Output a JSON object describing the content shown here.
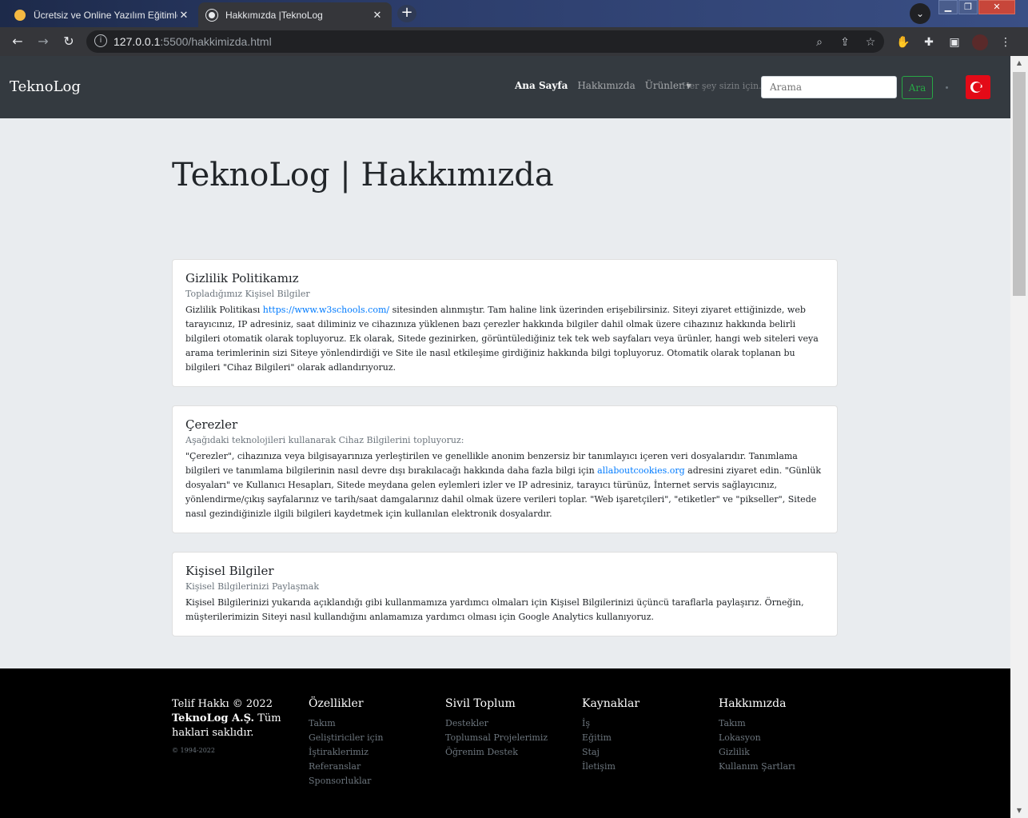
{
  "browser": {
    "tabs": [
      {
        "title": "Ücretsiz ve Online Yazılım Eğitimleri"
      },
      {
        "title": "Hakkımızda |TeknoLog"
      }
    ],
    "url_host": "127.0.0.1",
    "url_path": ":5500/hakkimizda.html"
  },
  "navbar": {
    "brand": "TeknoLog",
    "links": [
      {
        "label": "Ana Sayfa"
      },
      {
        "label": "Hakkımızda"
      },
      {
        "label": "Ürünler"
      }
    ],
    "tagline": "Her şey sizin için...",
    "search_placeholder": "Arama",
    "search_button": "Ara"
  },
  "main": {
    "title": "TeknoLog | Hakkımızda",
    "cards": [
      {
        "title": "Gizlilik Politikamız",
        "subtitle": "Topladığımız Kişisel Bilgiler",
        "text_before": "Gizlilik Politikası ",
        "link": "https://www.w3schools.com/",
        "text_after": " sitesinden alınmıştır. Tam haline link üzerinden erişebilirsiniz. Siteyi ziyaret ettiğinizde, web tarayıcınız, IP adresiniz, saat diliminiz ve cihazınıza yüklenen bazı çerezler hakkında bilgiler dahil olmak üzere cihazınız hakkında belirli bilgileri otomatik olarak topluyoruz. Ek olarak, Sitede gezinirken, görüntülediğiniz tek tek web sayfaları veya ürünler, hangi web siteleri veya arama terimlerinin sizi Siteye yönlendirdiği ve Site ile nasıl etkileşime girdiğiniz hakkında bilgi topluyoruz. Otomatik olarak toplanan bu bilgileri \"Cihaz Bilgileri\" olarak adlandırıyoruz."
      },
      {
        "title": "Çerezler",
        "subtitle": "Aşağıdaki teknolojileri kullanarak Cihaz Bilgilerini topluyoruz:",
        "text_before": "\"Çerezler\", cihazınıza veya bilgisayarınıza yerleştirilen ve genellikle anonim benzersiz bir tanımlayıcı içeren veri dosyalarıdır. Tanımlama bilgileri ve tanımlama bilgilerinin nasıl devre dışı bırakılacağı hakkında daha fazla bilgi için ",
        "link": "allaboutcookies.org",
        "text_after": " adresini ziyaret edin. \"Günlük dosyaları\" ve Kullanıcı Hesapları, Sitede meydana gelen eylemleri izler ve IP adresiniz, tarayıcı türünüz, İnternet servis sağlayıcınız, yönlendirme/çıkış sayfalarınız ve tarih/saat damgalarınız dahil olmak üzere verileri toplar. \"Web işaretçileri\", \"etiketler\" ve \"pikseller\", Sitede nasıl gezindiğinizle ilgili bilgileri kaydetmek için kullanılan elektronik dosyalardır."
      },
      {
        "title": "Kişisel Bilgiler",
        "subtitle": "Kişisel Bilgilerinizi Paylaşmak",
        "text_before": "Kişisel Bilgilerinizi yukarıda açıklandığı gibi kullanmamıza yardımcı olmaları için Kişisel Bilgilerinizi üçüncü taraflarla paylaşırız. Örneğin, müşterilerimizin Siteyi nasıl kullandığını anlamamıza yardımcı olması için Google Analytics kullanıyoruz.",
        "link": "",
        "text_after": ""
      }
    ]
  },
  "footer": {
    "copyright_1": "Telif Hakkı © 2022",
    "copyright_company": "TeknoLog A.Ş.",
    "copyright_2": " Tüm haklari saklıdır.",
    "years": "© 1994-2022",
    "columns": [
      {
        "heading": "Özellikler",
        "links": [
          "Takım",
          "Geliştiriciler için",
          "İştiraklerimiz",
          "Referanslar",
          "Sponsorluklar"
        ]
      },
      {
        "heading": "Sivil Toplum",
        "links": [
          "Destekler",
          "Toplumsal Projelerimiz",
          "Öğrenim Destek"
        ]
      },
      {
        "heading": "Kaynaklar",
        "links": [
          "İş",
          "Eğitim",
          "Staj",
          "İletişim"
        ]
      },
      {
        "heading": "Hakkımızda",
        "links": [
          "Takım",
          "Lokasyon",
          "Gizlilik",
          "Kullanım Şartları"
        ]
      }
    ]
  }
}
